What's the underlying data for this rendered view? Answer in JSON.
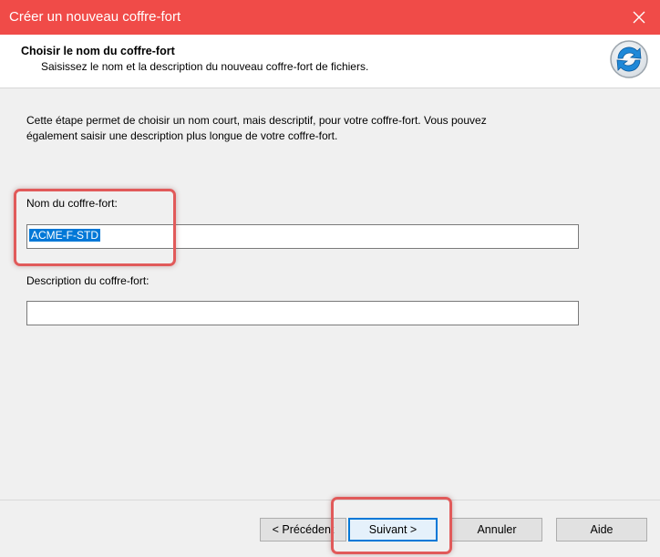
{
  "window": {
    "title": "Créer un nouveau coffre-fort",
    "accent_color": "#f04b48"
  },
  "header": {
    "title": "Choisir le nom du coffre-fort",
    "subtitle": "Saisissez le nom et la description du nouveau coffre-fort de fichiers.",
    "icon": "refresh-arrows-icon"
  },
  "main": {
    "intro_line1": "Cette étape permet de choisir un nom court, mais descriptif, pour votre coffre-fort. Vous pouvez",
    "intro_line2": "également saisir une description plus longue de votre coffre-fort.",
    "name_label": "Nom du coffre-fort:",
    "name_value": "ACME-F-STD",
    "description_label": "Description du coffre-fort:",
    "description_value": ""
  },
  "buttons": {
    "previous": "< Précédent",
    "next": "Suivant >",
    "cancel": "Annuler",
    "help": "Aide"
  }
}
